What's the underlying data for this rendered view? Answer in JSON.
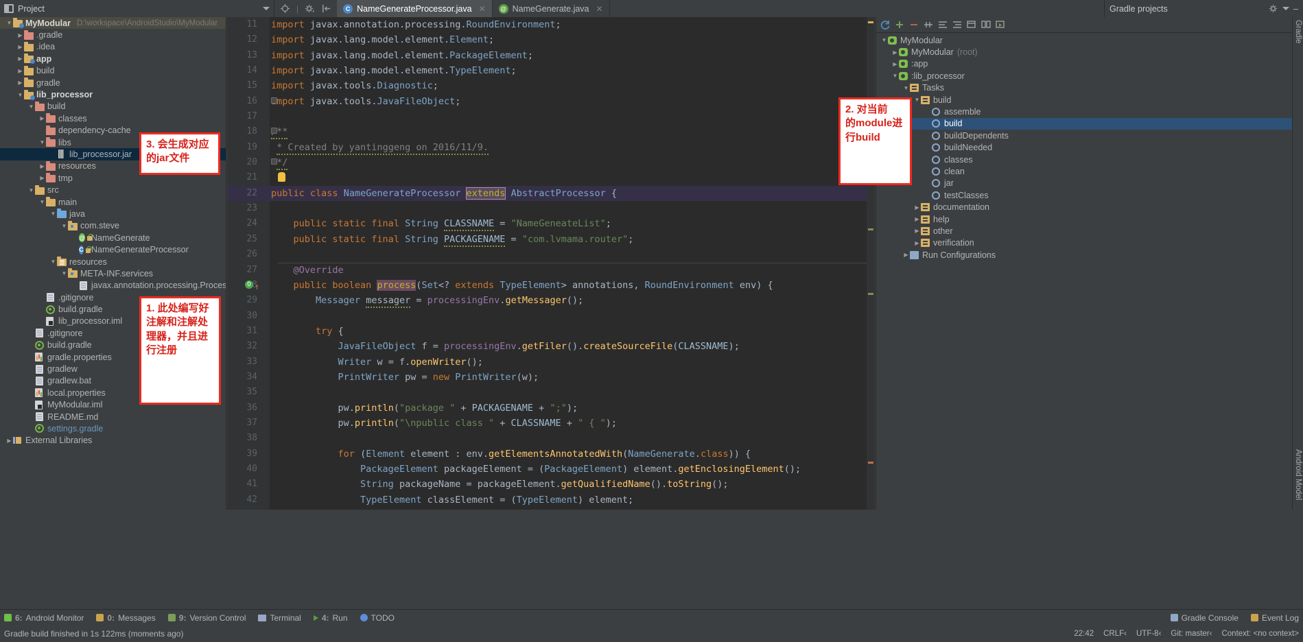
{
  "window": {
    "project_panel_title": "Project",
    "gradle_panel_title": "Gradle projects"
  },
  "project_tree": [
    {
      "depth": 0,
      "arrow": "down",
      "icon": "module-folder",
      "label": "MyModular",
      "bold": true,
      "path": "D:\\workspace\\AndroidStudio\\MyModular",
      "highlight": "top"
    },
    {
      "depth": 1,
      "arrow": "right",
      "icon": "folder-red",
      "label": ".gradle"
    },
    {
      "depth": 1,
      "arrow": "right",
      "icon": "folder-yellow",
      "label": ".idea"
    },
    {
      "depth": 1,
      "arrow": "right",
      "icon": "module-folder-app",
      "label": "app",
      "bold": true
    },
    {
      "depth": 1,
      "arrow": "right",
      "icon": "folder-yellow",
      "label": "build"
    },
    {
      "depth": 1,
      "arrow": "right",
      "icon": "folder-yellow",
      "label": "gradle"
    },
    {
      "depth": 1,
      "arrow": "down",
      "icon": "module-folder",
      "label": "lib_processor",
      "bold": true
    },
    {
      "depth": 2,
      "arrow": "down",
      "icon": "folder-red",
      "label": "build"
    },
    {
      "depth": 3,
      "arrow": "right",
      "icon": "folder-red",
      "label": "classes"
    },
    {
      "depth": 3,
      "arrow": "none",
      "icon": "folder-red",
      "label": "dependency-cache"
    },
    {
      "depth": 3,
      "arrow": "down",
      "icon": "folder-red",
      "label": "libs"
    },
    {
      "depth": 4,
      "arrow": "none",
      "icon": "jar",
      "label": "lib_processor.jar",
      "highlight": "selected"
    },
    {
      "depth": 3,
      "arrow": "right",
      "icon": "folder-red",
      "label": "resources"
    },
    {
      "depth": 3,
      "arrow": "right",
      "icon": "folder-red",
      "label": "tmp"
    },
    {
      "depth": 2,
      "arrow": "down",
      "icon": "folder-yellow",
      "label": "src"
    },
    {
      "depth": 3,
      "arrow": "down",
      "icon": "folder-yellow",
      "label": "main"
    },
    {
      "depth": 4,
      "arrow": "down",
      "icon": "folder-blue",
      "label": "java"
    },
    {
      "depth": 5,
      "arrow": "down",
      "icon": "folder-package",
      "label": "com.steve"
    },
    {
      "depth": 6,
      "arrow": "none",
      "icon": "annotation-class",
      "label": "NameGenerate"
    },
    {
      "depth": 6,
      "arrow": "none",
      "icon": "java-class",
      "label": "NameGenerateProcessor"
    },
    {
      "depth": 4,
      "arrow": "down",
      "icon": "folder-resources",
      "label": "resources"
    },
    {
      "depth": 5,
      "arrow": "down",
      "icon": "folder-package",
      "label": "META-INF.services"
    },
    {
      "depth": 6,
      "arrow": "none",
      "icon": "file",
      "label": "javax.annotation.processing.Processor"
    },
    {
      "depth": 3,
      "arrow": "none",
      "icon": "file",
      "label": ".gitignore"
    },
    {
      "depth": 3,
      "arrow": "none",
      "icon": "gradle-file",
      "label": "build.gradle"
    },
    {
      "depth": 3,
      "arrow": "none",
      "icon": "iml-file",
      "label": "lib_processor.iml"
    },
    {
      "depth": 2,
      "arrow": "none",
      "icon": "file",
      "label": ".gitignore"
    },
    {
      "depth": 2,
      "arrow": "none",
      "icon": "gradle-file",
      "label": "build.gradle"
    },
    {
      "depth": 2,
      "arrow": "none",
      "icon": "properties-file",
      "label": "gradle.properties"
    },
    {
      "depth": 2,
      "arrow": "none",
      "icon": "file",
      "label": "gradlew"
    },
    {
      "depth": 2,
      "arrow": "none",
      "icon": "file",
      "label": "gradlew.bat"
    },
    {
      "depth": 2,
      "arrow": "none",
      "icon": "properties-file",
      "label": "local.properties"
    },
    {
      "depth": 2,
      "arrow": "none",
      "icon": "iml-file",
      "label": "MyModular.iml"
    },
    {
      "depth": 2,
      "arrow": "none",
      "icon": "file",
      "label": "README.md"
    },
    {
      "depth": 2,
      "arrow": "none",
      "icon": "gradle-file",
      "label": "settings.gradle",
      "link": true
    },
    {
      "depth": 0,
      "arrow": "right",
      "icon": "library",
      "label": "External Libraries"
    }
  ],
  "editor_tabs": [
    {
      "label": "NameGenerateProcessor.java",
      "icon": "java-class",
      "active": true,
      "closable": true
    },
    {
      "label": "NameGenerate.java",
      "icon": "annotation-class",
      "active": false,
      "closable": true
    }
  ],
  "code_lines": [
    {
      "n": 11,
      "html": "<span class=\"kw\">import</span> <span class=\"typ\">javax.annotation.processing.</span><span class=\"cls\">RoundEnvironment</span>;"
    },
    {
      "n": 12,
      "html": "<span class=\"kw\">import</span> <span class=\"typ\">javax.lang.model.element.</span><span class=\"cls\">Element</span>;"
    },
    {
      "n": 13,
      "html": "<span class=\"kw\">import</span> <span class=\"typ\">javax.lang.model.element.</span><span class=\"cls\">PackageElement</span>;"
    },
    {
      "n": 14,
      "html": "<span class=\"kw\">import</span> <span class=\"typ\">javax.lang.model.element.</span><span class=\"cls\">TypeElement</span>;"
    },
    {
      "n": 15,
      "html": "<span class=\"kw\">import</span> <span class=\"typ\">javax.tools.</span><span class=\"cls\">Diagnostic</span>;"
    },
    {
      "n": 16,
      "html": "<span class=\"kw\">import</span> <span class=\"typ\">javax.tools.</span><span class=\"cls\">JavaFileObject</span>;",
      "fold": "end"
    },
    {
      "n": 17,
      "html": ""
    },
    {
      "n": 18,
      "html": "<span class=\"cmt squig\">/**</span>",
      "fold": "start"
    },
    {
      "n": 19,
      "html": " <span class=\"cmt squig\">* Created by yantinggeng on 2016/11/9.</span>"
    },
    {
      "n": 20,
      "html": " <span class=\"cmt squig\">*/</span>",
      "fold": "end2"
    },
    {
      "n": 21,
      "html": "",
      "bulb": true
    },
    {
      "n": 22,
      "html": "<span class=\"kw\">public class</span> <span class=\"cls\">NameGenerateProcessor</span> <span class=\"hl-extends\">extends</span> <span class=\"cls\">AbstractProcessor</span> {",
      "current": true
    },
    {
      "n": 23,
      "html": ""
    },
    {
      "n": 24,
      "html": "    <span class=\"kw\">public static final</span> <span class=\"cls\">String</span> <span class=\"stat squig\">CLASSNAME</span> = <span class=\"str\">\"NameGeneateList\"</span>;"
    },
    {
      "n": 25,
      "html": "    <span class=\"kw\">public static final</span> <span class=\"cls\">String</span> <span class=\"stat squig\">PACKAGENAME</span> = <span class=\"str\">\"com.lvmama.router\"</span>;"
    },
    {
      "n": 26,
      "html": ""
    },
    {
      "n": 27,
      "html": "    <span class=\"fld2\">@Override</span>",
      "sep": true
    },
    {
      "n": 28,
      "html": "    <span class=\"kw\">public boolean</span> <span class=\"hl-proc\">process</span>(<span class=\"cls\">Set</span>&lt;? <span class=\"kw\">extends</span> <span class=\"cls\">TypeElement</span>&gt; annotations, <span class=\"cls\">RoundEnvironment</span> env) {",
      "marker": "override"
    },
    {
      "n": 29,
      "html": "        <span class=\"cls\">Messager</span> <span class=\"squig\">messager</span> = <span class=\"fld2\">processingEnv</span>.<span class=\"mth\">getMessager</span>();"
    },
    {
      "n": 30,
      "html": ""
    },
    {
      "n": 31,
      "html": "        <span class=\"kw\">try</span> {"
    },
    {
      "n": 32,
      "html": "            <span class=\"cls\">JavaFileObject</span> f = <span class=\"fld2\">processingEnv</span>.<span class=\"mth\">getFiler</span>().<span class=\"mth\">createSourceFile</span>(<span class=\"stat\">CLASSNAME</span>);"
    },
    {
      "n": 33,
      "html": "            <span class=\"cls\">Writer</span> w = f.<span class=\"mth\">openWriter</span>();"
    },
    {
      "n": 34,
      "html": "            <span class=\"cls\">PrintWriter</span> pw = <span class=\"kw\">new</span> <span class=\"cls\">PrintWriter</span>(w);"
    },
    {
      "n": 35,
      "html": ""
    },
    {
      "n": 36,
      "html": "            pw.<span class=\"mth\">println</span>(<span class=\"str\">\"package \"</span> + <span class=\"stat\">PACKAGENAME</span> + <span class=\"str\">\";\"</span>);"
    },
    {
      "n": 37,
      "html": "            pw.<span class=\"mth\">println</span>(<span class=\"str\">\"\\npublic class \"</span> + <span class=\"stat\">CLASSNAME</span> + <span class=\"str\">\" { \"</span>);"
    },
    {
      "n": 38,
      "html": ""
    },
    {
      "n": 39,
      "html": "            <span class=\"kw\">for</span> (<span class=\"cls\">Element</span> element : env.<span class=\"mth\">getElementsAnnotatedWith</span>(<span class=\"cls\">NameGenerate</span>.<span class=\"kw\">class</span>)) {"
    },
    {
      "n": 40,
      "html": "                <span class=\"cls\">PackageElement</span> packageElement = (<span class=\"cls\">PackageElement</span>) element.<span class=\"mth\">getEnclosingElement</span>();"
    },
    {
      "n": 41,
      "html": "                <span class=\"cls\">String</span> packageName = packageElement.<span class=\"mth\">getQualifiedName</span>().<span class=\"mth\">toString</span>();"
    },
    {
      "n": 42,
      "html": "                <span class=\"cls\">TypeElement</span> classElement = (<span class=\"cls\">TypeElement</span>) element;"
    }
  ],
  "gradle_tree": [
    {
      "depth": 0,
      "arrow": "down",
      "icon": "gradle",
      "label": "MyModular"
    },
    {
      "depth": 1,
      "arrow": "right",
      "icon": "gradle",
      "label": "MyModular",
      "suffix": "(root)"
    },
    {
      "depth": 1,
      "arrow": "right",
      "icon": "gradle",
      "label": ":app"
    },
    {
      "depth": 1,
      "arrow": "down",
      "icon": "gradle",
      "label": ":lib_processor"
    },
    {
      "depth": 2,
      "arrow": "down",
      "icon": "tasks",
      "label": "Tasks"
    },
    {
      "depth": 3,
      "arrow": "down",
      "icon": "tasks",
      "label": "build"
    },
    {
      "depth": 4,
      "arrow": "none",
      "icon": "task",
      "label": "assemble"
    },
    {
      "depth": 4,
      "arrow": "none",
      "icon": "task",
      "label": "build",
      "selected": true
    },
    {
      "depth": 4,
      "arrow": "none",
      "icon": "task",
      "label": "buildDependents"
    },
    {
      "depth": 4,
      "arrow": "none",
      "icon": "task",
      "label": "buildNeeded"
    },
    {
      "depth": 4,
      "arrow": "none",
      "icon": "task",
      "label": "classes"
    },
    {
      "depth": 4,
      "arrow": "none",
      "icon": "task",
      "label": "clean"
    },
    {
      "depth": 4,
      "arrow": "none",
      "icon": "task",
      "label": "jar"
    },
    {
      "depth": 4,
      "arrow": "none",
      "icon": "task",
      "label": "testClasses"
    },
    {
      "depth": 3,
      "arrow": "right",
      "icon": "tasks",
      "label": "documentation"
    },
    {
      "depth": 3,
      "arrow": "right",
      "icon": "tasks",
      "label": "help"
    },
    {
      "depth": 3,
      "arrow": "right",
      "icon": "tasks",
      "label": "other"
    },
    {
      "depth": 3,
      "arrow": "right",
      "icon": "tasks",
      "label": "verification"
    },
    {
      "depth": 2,
      "arrow": "right",
      "icon": "runcfg",
      "label": "Run Configurations"
    }
  ],
  "callouts": [
    {
      "id": "callout-3",
      "text_lines": [
        "3. 会生成对应",
        "的jar文件"
      ]
    },
    {
      "id": "callout-2",
      "text_lines": [
        "2. 对当前",
        "的module进",
        "行build"
      ]
    },
    {
      "id": "callout-1",
      "text_lines": [
        "1. 此处编写好",
        "注解和注解处",
        "理器，并且进",
        "行注册"
      ]
    }
  ],
  "right_vertical_tabs": [
    "Gradle",
    "Android Model"
  ],
  "bottom_toolbar": {
    "items": [
      {
        "num": "6:",
        "label": "Android Monitor",
        "icon": "monitor-icon"
      },
      {
        "num": "0:",
        "label": "Messages",
        "icon": "messages-icon"
      },
      {
        "num": "9:",
        "label": "Version Control",
        "icon": "vcs-icon"
      },
      {
        "num": "",
        "label": "Terminal",
        "icon": "terminal-icon"
      },
      {
        "num": "4:",
        "label": "Run",
        "icon": "run-icon"
      },
      {
        "num": "",
        "label": "TODO",
        "icon": "todo-icon"
      }
    ],
    "right_items": [
      {
        "label": "Gradle Console",
        "icon": "console-icon"
      },
      {
        "label": "Event Log",
        "icon": "eventlog-icon"
      }
    ]
  },
  "status_bar": {
    "message": "Gradle build finished in 1s 122ms (moments ago)",
    "caret": "22:42",
    "line_sep": "CRLF‹",
    "encoding": "UTF-8‹",
    "git": "Git: master‹",
    "context": "Context: <no context>"
  }
}
